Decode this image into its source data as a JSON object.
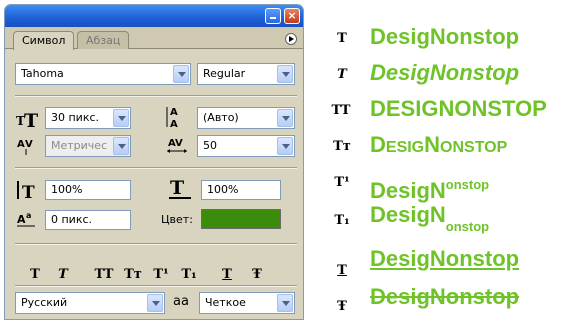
{
  "panel": {
    "title_buttons": {
      "minimize": "",
      "close": "×"
    },
    "tabs": [
      {
        "label": "Символ"
      },
      {
        "label": "Абзац"
      }
    ],
    "font_family": "Tahoma",
    "font_style": "Regular",
    "font_size": "30 пикс.",
    "leading": "(Авто)",
    "kerning": "Метричес",
    "tracking": "50",
    "vertical_scale": "100%",
    "horizontal_scale": "100%",
    "baseline_shift": "0 пикс.",
    "color_label": "Цвет:",
    "color_value": "#3c8c0c",
    "style_buttons": [
      {
        "glyph": "T",
        "name": "faux-bold"
      },
      {
        "glyph": "T",
        "name": "faux-italic"
      },
      {
        "glyph": "TT",
        "name": "all-caps"
      },
      {
        "glyph": "Tт",
        "name": "small-caps"
      },
      {
        "glyph": "T¹",
        "name": "superscript"
      },
      {
        "glyph": "T₁",
        "name": "subscript"
      },
      {
        "glyph": "T",
        "name": "underline"
      },
      {
        "glyph": "Ŧ",
        "name": "strikethrough"
      }
    ],
    "language": "Русский",
    "antialias_icon": "aa",
    "antialias": "Четкое"
  },
  "examples": {
    "bold": {
      "icon": "T",
      "text": "DesigNonstop"
    },
    "italic": {
      "icon": "T",
      "text": "DesigNonstop"
    },
    "all_caps": {
      "icon": "TT",
      "text": "DESIGNONSTOP"
    },
    "small_caps": {
      "icon": "Tт",
      "parts": [
        "D",
        "ESIG",
        "N",
        "ONSTOP"
      ]
    },
    "superscript": {
      "icon": "T¹",
      "base": "DesigN",
      "script": "onstop"
    },
    "subscript": {
      "icon": "T₁",
      "base": "DesigN",
      "script": "onstop"
    },
    "underline": {
      "icon": "T",
      "text": "DesigNonstop"
    },
    "strikethrough": {
      "icon": "Ŧ",
      "text": "DesigNonstop"
    },
    "accent_color": "#6fc329"
  }
}
